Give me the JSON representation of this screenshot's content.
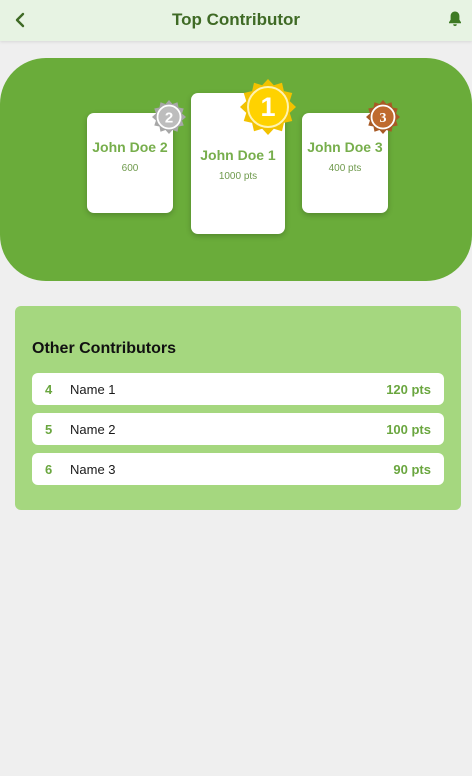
{
  "appbar": {
    "title": "Top Contributor",
    "back_icon": "chevron-left-icon",
    "bell_icon": "bell-icon"
  },
  "podium": [
    {
      "rank": "2",
      "name": "John Doe 2",
      "points": "600",
      "medal_color": "#b0b0b0"
    },
    {
      "rank": "1",
      "name": "John Doe 1",
      "points": "1000 pts",
      "medal_color": "#f5c800"
    },
    {
      "rank": "3",
      "name": "John Doe 3",
      "points": "400 pts",
      "medal_color": "#b8632a"
    }
  ],
  "others": {
    "heading": "Other Contributors",
    "rows": [
      {
        "rank": "4",
        "name": "Name 1",
        "points": "120 pts"
      },
      {
        "rank": "5",
        "name": "Name 2",
        "points": "100 pts"
      },
      {
        "rank": "6",
        "name": "Name 3",
        "points": "90 pts"
      }
    ]
  },
  "colors": {
    "accent": "#6aac3a",
    "panel_light": "#a5d77f",
    "title_text": "#3f6a25",
    "appbar_bg": "#e7f3e3"
  }
}
